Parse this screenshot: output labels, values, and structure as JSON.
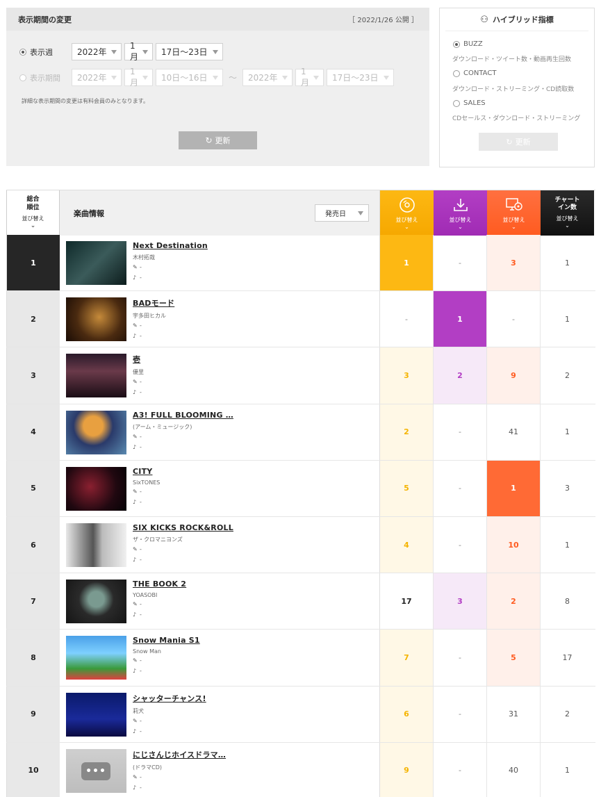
{
  "period": {
    "title": "表示期間の変更",
    "published": "［ 2022/1/26 公開 ］",
    "week_label": "表示週",
    "range_label": "表示期間",
    "week": {
      "year": "2022年",
      "month": "1月",
      "span": "17日〜23日"
    },
    "range_from": {
      "year": "2022年",
      "month": "1月",
      "span": "10日〜16日"
    },
    "tilde": "〜",
    "range_to": {
      "year": "2022年",
      "month": "1月",
      "span": "17日〜23日"
    },
    "note": "詳細な表示期間の変更は有料会員のみとなります。",
    "update_label": "更新",
    "update_icon": "↻"
  },
  "hybrid": {
    "title": "ハイブリッド指標",
    "icon": "⚇",
    "options": [
      {
        "label": "BUZZ",
        "desc": "ダウンロード・ツイート数・動画再生回数",
        "selected": true
      },
      {
        "label": "CONTACT",
        "desc": "ダウンロード・ストリーミング・CD読取数",
        "selected": false
      },
      {
        "label": "SALES",
        "desc": "CDセールス・ダウンロード・ストリーミング",
        "selected": false
      }
    ],
    "update_label": "更新",
    "update_icon": "↻"
  },
  "table": {
    "rank_header_1": "総合",
    "rank_header_2": "順位",
    "sort_label": "並び替え",
    "info_header": "楽曲情報",
    "sort_select": "発売日",
    "chart_in_1": "チャート",
    "chart_in_2": "イン数",
    "col_colors": {
      "cd": "#fdb813",
      "dl": "#b23ec4",
      "st": "#ff6a35",
      "ci": "#222222"
    }
  },
  "rows": [
    {
      "rank": "1",
      "title": "Next Destination",
      "artist": "木村拓哉",
      "writer": "-",
      "composer": "-",
      "cd": "1",
      "dl": "-",
      "st": "3",
      "ci": "1"
    },
    {
      "rank": "2",
      "title": "BADモード",
      "artist": "宇多田ヒカル",
      "writer": "-",
      "composer": "-",
      "cd": "-",
      "dl": "1",
      "st": "-",
      "ci": "1"
    },
    {
      "rank": "3",
      "title": "壱",
      "artist": "優里",
      "writer": "-",
      "composer": "-",
      "cd": "3",
      "dl": "2",
      "st": "9",
      "ci": "2"
    },
    {
      "rank": "4",
      "title": "A3! FULL BLOOMING …",
      "artist": "(アーム・ミュージック)",
      "writer": "-",
      "composer": "-",
      "cd": "2",
      "dl": "-",
      "st": "41",
      "ci": "1"
    },
    {
      "rank": "5",
      "title": "CITY",
      "artist": "SixTONES",
      "writer": "-",
      "composer": "-",
      "cd": "5",
      "dl": "-",
      "st": "1",
      "ci": "3"
    },
    {
      "rank": "6",
      "title": "SIX KICKS ROCK&ROLL",
      "artist": "ザ・クロマニヨンズ",
      "writer": "-",
      "composer": "-",
      "cd": "4",
      "dl": "-",
      "st": "10",
      "ci": "1"
    },
    {
      "rank": "7",
      "title": "THE BOOK 2",
      "artist": "YOASOBI",
      "writer": "-",
      "composer": "-",
      "cd": "17",
      "dl": "3",
      "st": "2",
      "ci": "8"
    },
    {
      "rank": "8",
      "title": "Snow Mania S1",
      "artist": "Snow Man",
      "writer": "-",
      "composer": "-",
      "cd": "7",
      "dl": "-",
      "st": "5",
      "ci": "17"
    },
    {
      "rank": "9",
      "title": "シャッターチャンス!",
      "artist": "莉犬",
      "writer": "-",
      "composer": "-",
      "cd": "6",
      "dl": "-",
      "st": "31",
      "ci": "2"
    },
    {
      "rank": "10",
      "title": "にじさんじホイスドラマ…",
      "artist": "(ドラマCD)",
      "writer": "-",
      "composer": "-",
      "cd": "9",
      "dl": "-",
      "st": "40",
      "ci": "1"
    }
  ]
}
